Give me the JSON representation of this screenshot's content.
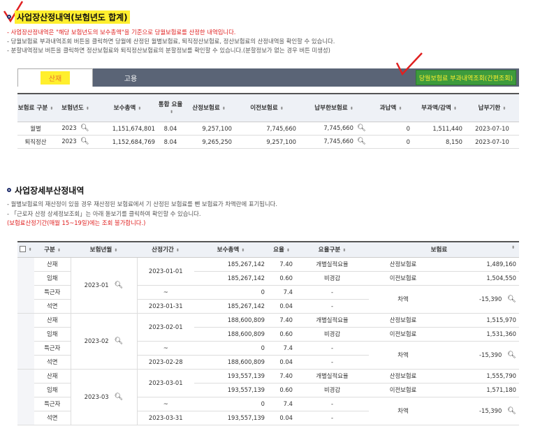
{
  "section1": {
    "title": "사업장산정내역(보험년도 합계)",
    "notes": [
      {
        "text": "- 사업장산정내역은 \"해당 보험년도의 보수총액\"을 기준으로 당월보험료를 산정한 내역입니다.",
        "color": "red"
      },
      {
        "text": "- 당월보험료 부과내역조회 버튼을 클릭하면 당월에 산정된 월별보험료, 퇴직정산보험료, 정산보험료의 산정내역을 확인할 수 있습니다.",
        "color": "gray"
      },
      {
        "text": "- 분할내역정보 버튼을 클릭하면 정산보험료와 퇴직정산보험료의  분할정보를 확인할 수 있습니다.(분할정보가 없는 경우 버튼 미생성)",
        "color": "gray"
      }
    ],
    "tabs": {
      "active": "산재",
      "other": "고용"
    },
    "inquiry_button": "당월보험료 부과내역조회(간편조회)",
    "columns": [
      "보험료 구분",
      "보험년도",
      "보수총액",
      "통합 요율",
      "산정보험료",
      "이전보험료",
      "납부한보험료",
      "과납액",
      "부과액/감액",
      "납부기한"
    ],
    "rows": [
      {
        "type": "월별",
        "year": "2023",
        "wage": "1,151,674,801",
        "rate": "8.04",
        "calc": "9,257,100",
        "prev": "7,745,660",
        "paid": "7,745,660",
        "over": "0",
        "levy": "1,511,440",
        "due": "2023-07-10"
      },
      {
        "type": "퇴직정산",
        "year": "2023",
        "wage": "1,152,684,769",
        "rate": "8.04",
        "calc": "9,265,250",
        "prev": "9,257,100",
        "paid": "7,745,660",
        "over": "0",
        "levy": "8,150",
        "due": "2023-07-10"
      }
    ]
  },
  "section2": {
    "title": "사업장세부산정내역",
    "notes": [
      {
        "text": "- 월별보험료의 재산정이 있을 경우 재산정된 보험료에서 기 산정된 보험료를 뺀 보험료가 차액란에 표기됩니다.",
        "color": "gray"
      },
      {
        "text": "- 「근로자 산정 상세정보조회」는 아래 돋보기를 클릭하여 확인할 수 있습니다.",
        "color": "gray"
      },
      {
        "text": "(보험료산정기간(매월 15~19일)에는 조회 불가합니다.)",
        "color": "red"
      }
    ],
    "columns": [
      "구분",
      "보험년월",
      "산정기간",
      "보수총액",
      "요율",
      "요율구분",
      "보험료"
    ],
    "months": [
      {
        "ym": "2023-01",
        "from": "2023-01-01",
        "to": "2023-01-31",
        "tilde": "~",
        "lines": [
          {
            "kind": "산재",
            "wage": "185,267,142",
            "rate": "7.40",
            "rtype": "개별실적요율"
          },
          {
            "kind": "임채",
            "wage": "185,267,142",
            "rate": "0.60",
            "rtype": "비경감"
          },
          {
            "kind": "특근자",
            "wage": "0",
            "rate": "7.4",
            "rtype": "-"
          },
          {
            "kind": "석면",
            "wage": "185,267,142",
            "rate": "0.04",
            "rtype": "-"
          }
        ],
        "prem": [
          {
            "label": "산정보험료",
            "value": "1,489,160"
          },
          {
            "label": "이전보험료",
            "value": "1,504,550"
          }
        ],
        "diff": {
          "label": "차액",
          "value": "-15,390"
        }
      },
      {
        "ym": "2023-02",
        "from": "2023-02-01",
        "to": "2023-02-28",
        "tilde": "~",
        "lines": [
          {
            "kind": "산재",
            "wage": "188,600,809",
            "rate": "7.40",
            "rtype": "개별실적요율"
          },
          {
            "kind": "임채",
            "wage": "188,600,809",
            "rate": "0.60",
            "rtype": "비경감"
          },
          {
            "kind": "특근자",
            "wage": "0",
            "rate": "7.4",
            "rtype": "-"
          },
          {
            "kind": "석면",
            "wage": "188,600,809",
            "rate": "0.04",
            "rtype": "-"
          }
        ],
        "prem": [
          {
            "label": "산정보험료",
            "value": "1,515,970"
          },
          {
            "label": "이전보험료",
            "value": "1,531,360"
          }
        ],
        "diff": {
          "label": "차액",
          "value": "-15,390"
        }
      },
      {
        "ym": "2023-03",
        "from": "2023-03-01",
        "to": "2023-03-31",
        "tilde": "~",
        "lines": [
          {
            "kind": "산재",
            "wage": "193,557,139",
            "rate": "7.40",
            "rtype": "개별실적요율"
          },
          {
            "kind": "임채",
            "wage": "193,557,139",
            "rate": "0.60",
            "rtype": "비경감"
          },
          {
            "kind": "특근자",
            "wage": "0",
            "rate": "7.4",
            "rtype": "-"
          },
          {
            "kind": "석면",
            "wage": "193,557,139",
            "rate": "0.04",
            "rtype": "-"
          }
        ],
        "prem": [
          {
            "label": "산정보험료",
            "value": "1,555,790"
          },
          {
            "label": "이전보험료",
            "value": "1,571,180"
          }
        ],
        "diff": {
          "label": "차액",
          "value": "-15,390"
        }
      }
    ]
  },
  "colors": {
    "highlight": "#ffef2e",
    "accent_red": "#e02020",
    "tabbar": "#5a6476",
    "button_green": "#3d9b3d"
  },
  "icons": {
    "search": "search-icon",
    "sort": "sort-icon"
  }
}
